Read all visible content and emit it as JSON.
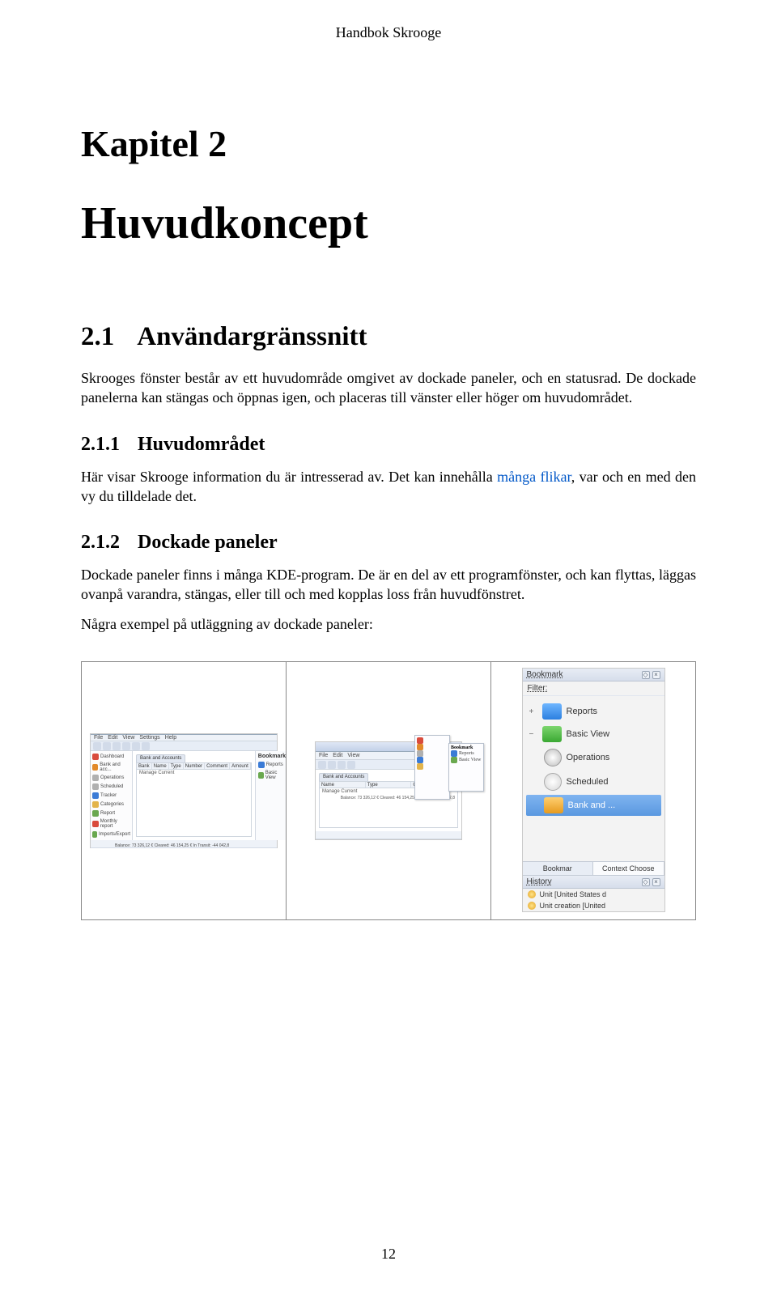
{
  "running_head": "Handbok Skrooge",
  "chapter": {
    "label": "Kapitel 2",
    "title": "Huvudkoncept"
  },
  "s21": {
    "num": "2.1",
    "title": "Användargränssnitt",
    "p1": "Skrooges fönster består av ett huvudområde omgivet av dockade paneler, och en statusrad. De dockade panelerna kan stängas och öppnas igen, och placeras till vänster eller höger om huvudområdet."
  },
  "s211": {
    "num": "2.1.1",
    "title": "Huvudområdet",
    "p_a": "Här visar Skrooge information du är intresserad av. Det kan innehålla ",
    "link": "många flikar",
    "p_b": ", var och en med den vy du tilldelade det."
  },
  "s212": {
    "num": "2.1.2",
    "title": "Dockade paneler",
    "p1": "Dockade paneler finns i många KDE-program. De är en del av ett programfönster, och kan flyttas, läggas ovanpå varandra, stängas, eller till och med kopplas loss från huvudfönstret.",
    "p2": "Några exempel på utläggning av dockade paneler:"
  },
  "shot_labels": {
    "sidebar": [
      "Dashboard",
      "Bank and acc...",
      "Operations",
      "Scheduled",
      "Tracker",
      "Categories",
      "Report",
      "Monthly report",
      "Imports/Export"
    ],
    "columns": [
      "Bank",
      "Name",
      "Type",
      "Number",
      "Comment",
      "Amount"
    ],
    "tab": "Bank and Accounts",
    "right_dock": "Bookmark",
    "right_items": [
      "Reports",
      "Basic View"
    ],
    "status": "Balance: 73 326,12 € Cleared: 46 154,25 € In Transit: -44 042,8",
    "filter_lead": "Manage Current"
  },
  "shot3": {
    "header": "Bookmark",
    "filter_label": "Filter:",
    "items": [
      {
        "label": "Reports",
        "kind": "folder-blue",
        "exp": "+"
      },
      {
        "label": "Basic View",
        "kind": "folder-green",
        "exp": "−"
      },
      {
        "label": "Operations",
        "kind": "icon-op",
        "exp": ""
      },
      {
        "label": "Scheduled",
        "kind": "icon-cl",
        "exp": ""
      },
      {
        "label": "Bank and ...",
        "kind": "folder-orange",
        "exp": "",
        "selected": true
      }
    ],
    "tabs": [
      "Bookmar",
      "Context Choose"
    ],
    "history_header": "History",
    "history": [
      "Unit [United States d",
      "Unit creation [United"
    ]
  },
  "page_number": "12"
}
